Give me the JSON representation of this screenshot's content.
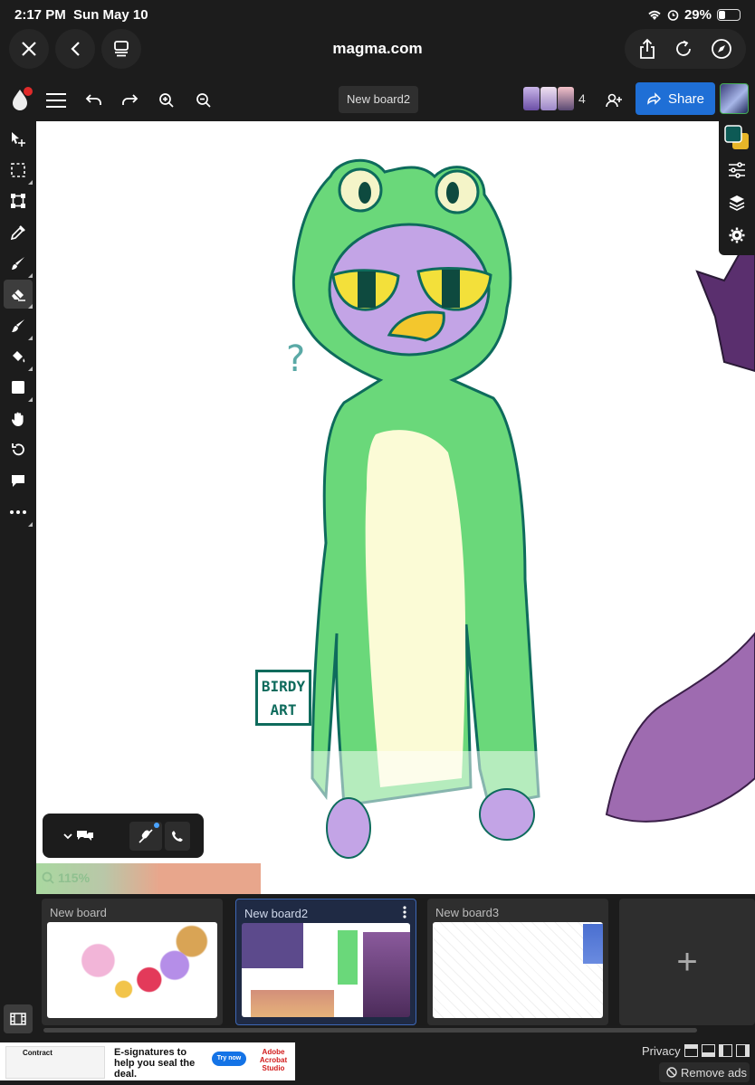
{
  "status_bar": {
    "time": "2:17 PM",
    "date": "Sun May 10",
    "battery": "29%"
  },
  "browser": {
    "url": "magma.com"
  },
  "toolbar": {
    "board_name": "New board2",
    "user_count": "4",
    "share_label": "Share"
  },
  "chat_widget": {
    "zoom": "115%"
  },
  "boards": [
    {
      "name": "New board"
    },
    {
      "name": "New board2"
    },
    {
      "name": "New board3"
    }
  ],
  "add_board_label": "+",
  "ad": {
    "headline": "E-signatures to help you seal the deal.",
    "cta": "Try now",
    "brand": "Adobe Acrobat Studio",
    "thumb_label": "Contract"
  },
  "footer": {
    "privacy": "Privacy",
    "remove_ads": "Remove ads"
  },
  "canvas_signature": "BIRDY ART",
  "colors": {
    "accent": "#1f6fd6",
    "primary_color": "#0d5a55",
    "secondary_color": "#e8b628",
    "canvas": "#ffffff"
  }
}
